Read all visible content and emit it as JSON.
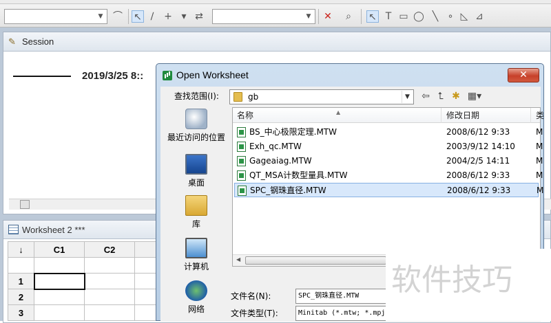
{
  "session": {
    "title": "Session",
    "text": "2019/3/25 8::"
  },
  "worksheet": {
    "title": "Worksheet 2 ***",
    "corner": "↓",
    "columns": [
      "C1",
      "C2",
      "C"
    ],
    "rows": [
      "1",
      "2",
      "3"
    ]
  },
  "dialog": {
    "title": "Open Worksheet",
    "close_label": "✕",
    "look_in_label": "查找范围(I):",
    "look_in_value": "gb",
    "places": [
      "最近访问的位置",
      "桌面",
      "库",
      "计算机",
      "网络"
    ],
    "columns": {
      "name": "名称",
      "date": "修改日期",
      "extra": "类"
    },
    "files": [
      {
        "name": "BS_中心极限定理.MTW",
        "date": "2008/6/12 9:33",
        "extra": "M"
      },
      {
        "name": "Exh_qc.MTW",
        "date": "2003/9/12 14:10",
        "extra": "M"
      },
      {
        "name": "Gageaiag.MTW",
        "date": "2004/2/5 14:11",
        "extra": "M"
      },
      {
        "name": "QT_MSA计数型量具.MTW",
        "date": "2008/6/12 9:33",
        "extra": "M"
      },
      {
        "name": "SPC_钢珠直径.MTW",
        "date": "2008/6/12 9:33",
        "extra": "M"
      }
    ],
    "selected_index": 4,
    "filename_label": "文件名(N):",
    "filename_value": "SPC_钢珠直径.MTW",
    "filetype_label": "文件类型(T):",
    "filetype_value": "Minitab (*.mtw; *.mpj)"
  },
  "watermark": "软件技巧",
  "colors": {
    "selection": "#d8e8fb",
    "dialog_frame": "#b7cde4",
    "close_button": "#c7402a"
  }
}
